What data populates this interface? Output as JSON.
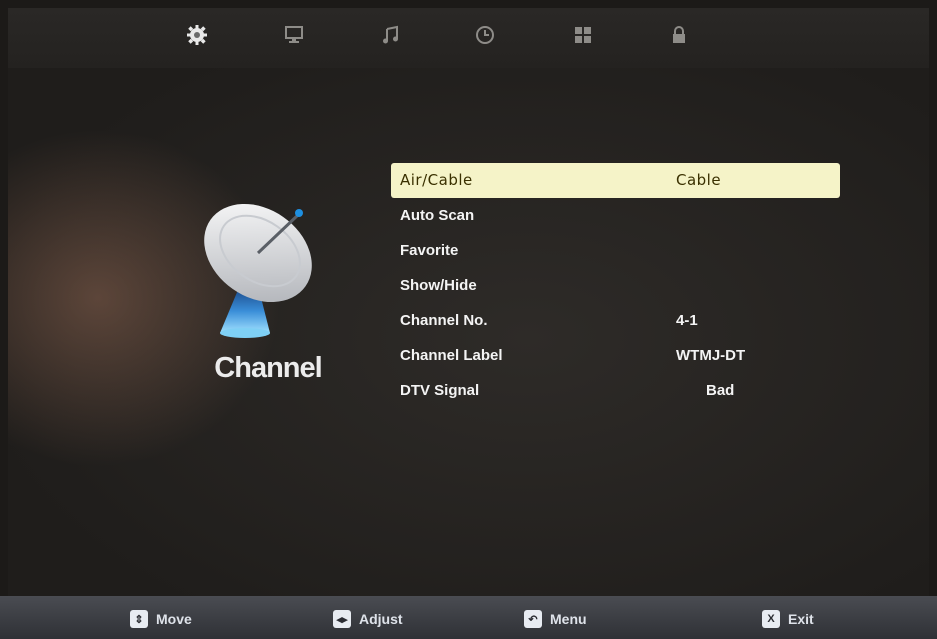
{
  "top_nav": {
    "items": [
      {
        "icon": "gear-icon"
      },
      {
        "icon": "monitor-icon"
      },
      {
        "icon": "music-note-icon"
      },
      {
        "icon": "clock-icon"
      },
      {
        "icon": "grid-icon"
      },
      {
        "icon": "lock-icon"
      }
    ]
  },
  "section": {
    "title": "Channel",
    "icon": "satellite-dish-icon"
  },
  "menu": {
    "rows": [
      {
        "label": "Air/Cable",
        "value": "Cable",
        "selected": true
      },
      {
        "label": "Auto Scan",
        "value": ""
      },
      {
        "label": "Favorite",
        "value": ""
      },
      {
        "label": "Show/Hide",
        "value": ""
      },
      {
        "label": "Channel No.",
        "value": "4-1"
      },
      {
        "label": "Channel Label",
        "value": "WTMJ-DT"
      },
      {
        "label": "DTV Signal",
        "value": "Bad"
      }
    ]
  },
  "footer": {
    "hints": [
      {
        "key_glyph": "⇕",
        "label": "Move"
      },
      {
        "key_glyph": "◂▸",
        "label": "Adjust"
      },
      {
        "key_glyph": "↶",
        "label": "Menu"
      },
      {
        "key_glyph": "X",
        "label": "Exit"
      }
    ]
  },
  "colors": {
    "selected_row_bg": "#f5f3c8",
    "text": "#f4f4f4",
    "background": "#2a2725"
  }
}
